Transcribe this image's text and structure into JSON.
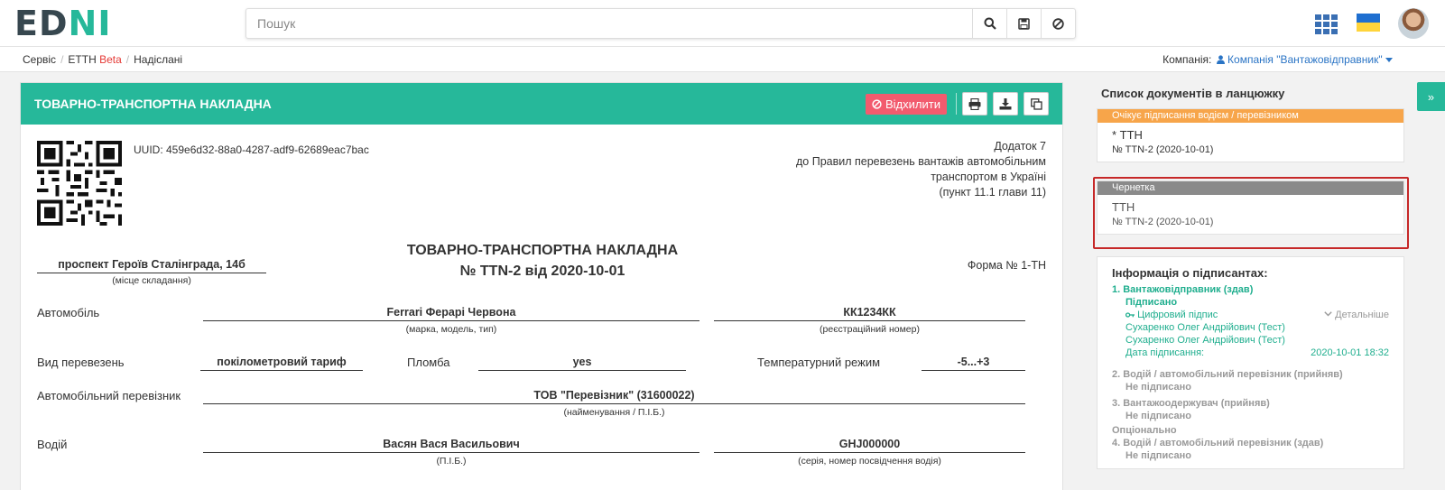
{
  "header": {
    "logo_ed": "ED",
    "logo_ni": "NI",
    "search_placeholder": "Пошук",
    "icons": [
      "search-icon",
      "save-icon",
      "ban-icon",
      "apps-grid-icon",
      "ukraine-flag-icon",
      "avatar"
    ]
  },
  "breadcrumb": {
    "items": [
      "Сервіс",
      "ЕТТН",
      "Надіслані"
    ],
    "beta": "Beta",
    "company_label": "Компанія:",
    "company_value": "Компанія \"Вантажовідправник\""
  },
  "document": {
    "header_title": "ТОВАРНО-ТРАНСПОРТНА НАКЛАДНА",
    "reject_label": "Відхилити",
    "uuid": "UUID: 459e6d32-88a0-4287-adf9-62689eac7bac",
    "appendix": [
      "Додаток 7",
      "до Правил перевезень вантажів автомобільним",
      "транспортом в Україні",
      "(пункт 11.1 глави 11)"
    ],
    "title_line1": "ТОВАРНО-ТРАНСПОРТНА НАКЛАДНА",
    "title_line2": "№ TTN-2 від 2020-10-01",
    "form_no": "Форма № 1-ТН",
    "place": "проспект Героїв Сталінграда, 14б",
    "place_caption": "(місце складання)",
    "car_label": "Автомобіль",
    "car_value": "Ferrari Ферарі Червона",
    "car_caption": "(марка, модель, тип)",
    "reg_value": "КК1234КК",
    "reg_caption": "(реєстраційний номер)",
    "transport_type_label": "Вид перевезень",
    "transport_type_value": "покілометровий тариф",
    "seal_label": "Пломба",
    "seal_value": "yes",
    "temp_label": "Температурний режим",
    "temp_value": "-5...+3",
    "carrier_label": "Автомобільний перевізник",
    "carrier_value": "ТОВ \"Перевізник\" (31600022)",
    "carrier_caption": "(найменування / П.І.Б.)",
    "driver_label": "Водій",
    "driver_value": "Васян Вася Васильович",
    "driver_caption": "(П.І.Б.)",
    "license_value": "GHJ000000",
    "license_caption": "(серія, номер посвідчення водія)"
  },
  "sidebar": {
    "title": "Список документів в ланцюжку",
    "cards": [
      {
        "status": "Очікує підписання водієм / перевізником",
        "status_color": "#f7a54a",
        "name": "* ТТН",
        "num": "№ TTN-2 (2020-10-01)"
      },
      {
        "status": "Чернетка",
        "status_color": "#8a8a8a",
        "name": "ТТН",
        "num": "№ TTN-2 (2020-10-01)"
      }
    ],
    "signers": {
      "title": "Інформація о підписантах:",
      "s1_name": "1.  Вантажовідправник (здав)",
      "s1_status": "Підписано",
      "s1_sig": "Цифровий підпис",
      "s1_details": "Детальніше",
      "s1_person1": "Сухаренко Олег Андрійович (Тест)",
      "s1_person2": "Сухаренко Олег Андрійович (Тест)",
      "s1_date_label": "Дата підписання:",
      "s1_date": "2020-10-01 18:32",
      "s2_name": "2.  Водій / автомобільний перевізник (прийняв)",
      "s2_status": "Не підписано",
      "s3_name": "3.  Вантажоодержувач (прийняв)",
      "s3_status": "Не підписано",
      "optional": "Опціонально",
      "s4_name": "4.  Водій / автомобільний перевізник (здав)",
      "s4_status": "Не підписано"
    },
    "expand": "»"
  }
}
